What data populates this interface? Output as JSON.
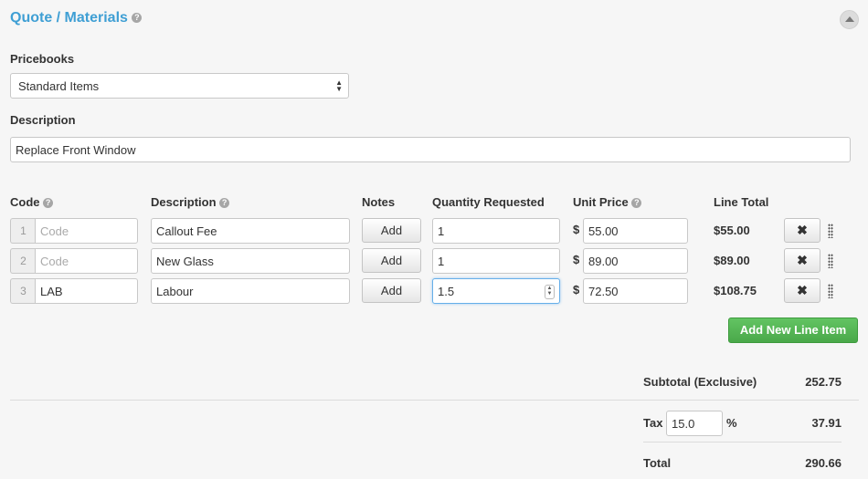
{
  "header": {
    "title": "Quote / Materials",
    "help_glyph": "?"
  },
  "pricebooks": {
    "label": "Pricebooks",
    "selected": "Standard Items"
  },
  "description": {
    "label": "Description",
    "value": "Replace Front Window"
  },
  "table": {
    "headers": {
      "code": "Code",
      "description": "Description",
      "notes": "Notes",
      "quantity": "Quantity Requested",
      "unit_price": "Unit Price",
      "line_total": "Line Total"
    },
    "rows": [
      {
        "index": "1",
        "code": "",
        "code_placeholder": "Code",
        "description": "Callout Fee",
        "notes_button": "Add",
        "quantity": "1",
        "currency": "$",
        "unit_price": "55.00",
        "line_total": "$55.00"
      },
      {
        "index": "2",
        "code": "",
        "code_placeholder": "Code",
        "description": "New Glass",
        "notes_button": "Add",
        "quantity": "1",
        "currency": "$",
        "unit_price": "89.00",
        "line_total": "$89.00"
      },
      {
        "index": "3",
        "code": "LAB",
        "code_placeholder": "Code",
        "description": "Labour",
        "notes_button": "Add",
        "quantity": "1.5",
        "currency": "$",
        "unit_price": "72.50",
        "line_total": "$108.75"
      }
    ],
    "delete_glyph": "✖",
    "add_line_button": "Add New Line Item"
  },
  "totals": {
    "subtotal_label": "Subtotal (Exclusive)",
    "subtotal_value": "252.75",
    "tax_label": "Tax",
    "tax_rate": "15.0",
    "tax_unit": "%",
    "tax_value": "37.91",
    "total_label": "Total",
    "total_value": "290.66"
  },
  "colors": {
    "accent": "#3f9fd4",
    "add_button": "#5cb85c",
    "focus": "#66afe9"
  },
  "icons": [
    "help-icon",
    "collapse-icon",
    "select-arrows-icon",
    "delete-icon",
    "drag-handle-icon",
    "spinner-icon"
  ]
}
